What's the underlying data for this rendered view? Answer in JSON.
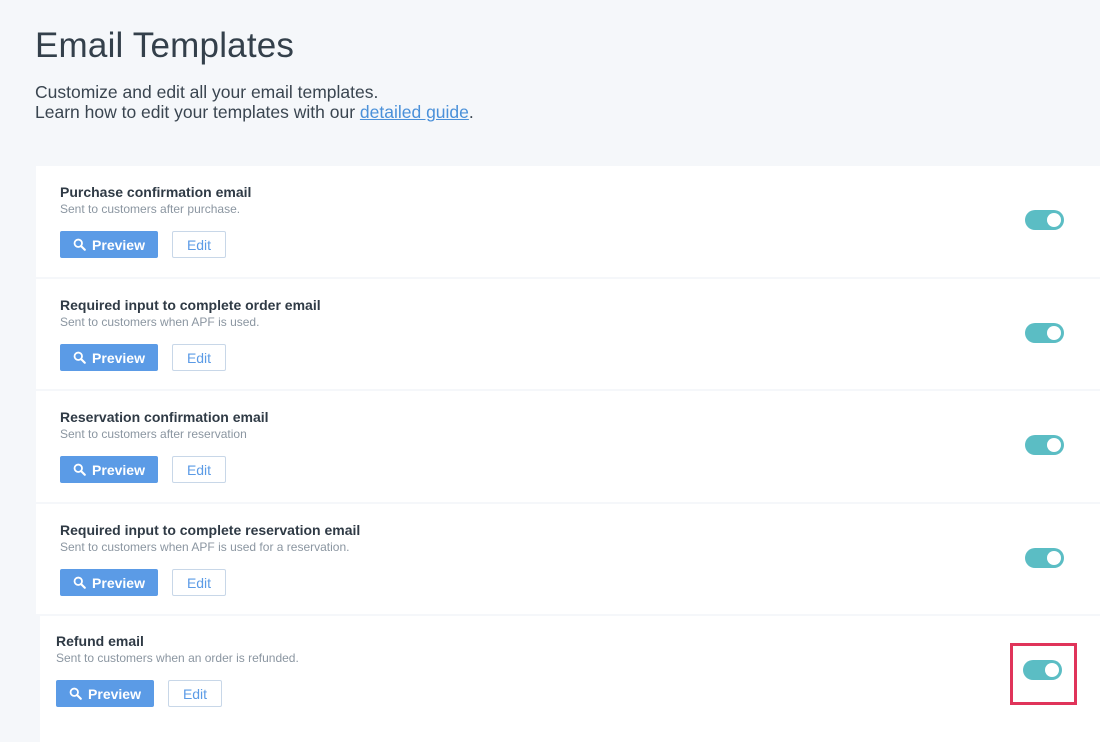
{
  "header": {
    "title": "Email Templates",
    "subtitle_line1": "Customize and edit all your email templates.",
    "subtitle_line2_prefix": "Learn how to edit your templates with our ",
    "guide_link": "detailed guide",
    "subtitle_line2_suffix": "."
  },
  "buttons": {
    "preview_label": "Preview",
    "edit_label": "Edit"
  },
  "templates": [
    {
      "name": "Purchase confirmation email",
      "description": "Sent to customers after purchase.",
      "enabled": true
    },
    {
      "name": "Required input to complete order email",
      "description": "Sent to customers when APF is used.",
      "enabled": true
    },
    {
      "name": "Reservation confirmation email",
      "description": "Sent to customers after reservation",
      "enabled": true
    },
    {
      "name": "Required input to complete reservation email",
      "description": "Sent to customers when APF is used for a reservation.",
      "enabled": true
    },
    {
      "name": "Refund email",
      "description": "Sent to customers when an order is refunded.",
      "enabled": true
    }
  ],
  "colors": {
    "accent": "#5b9be6",
    "toggle_on": "#5bbdc4",
    "highlight": "#e0345a",
    "link": "#4a90d9"
  }
}
